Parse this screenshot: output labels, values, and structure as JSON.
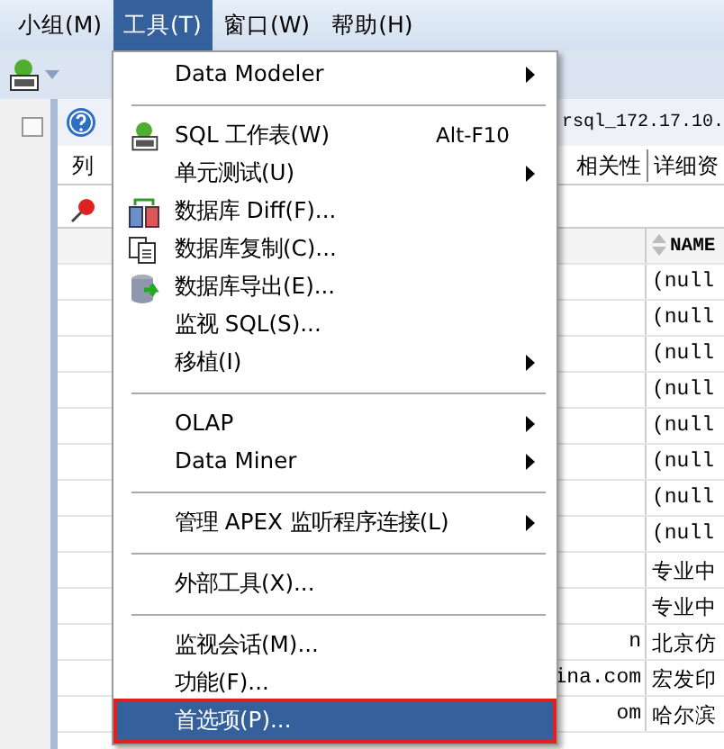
{
  "menubar": [
    {
      "label": "小组(M)",
      "selected": false
    },
    {
      "label": "工具(T)",
      "selected": true
    },
    {
      "label": "窗口(W)",
      "selected": false
    },
    {
      "label": "帮助(H)",
      "selected": false
    }
  ],
  "panel": {
    "title": "rsql_172.17.10.",
    "tabs": [
      {
        "label": "列"
      },
      {
        "label": "相关性"
      },
      {
        "label": "详细资"
      }
    ]
  },
  "grid": {
    "header": "NAME",
    "rows": [
      {
        "column_2": "",
        "name": "(null"
      },
      {
        "column_2": "",
        "name": "(null"
      },
      {
        "column_2": "",
        "name": "(null"
      },
      {
        "column_2": "",
        "name": "(null"
      },
      {
        "column_2": "",
        "name": "(null"
      },
      {
        "column_2": "",
        "name": "(null"
      },
      {
        "column_2": "",
        "name": "(null"
      },
      {
        "column_2": "",
        "name": "(null"
      },
      {
        "column_2": "",
        "name": "专业中"
      },
      {
        "column_2": "",
        "name": "专业中"
      },
      {
        "column_2": "n",
        "name": "北京仿"
      },
      {
        "column_2": "ina.com",
        "name": "宏发印"
      },
      {
        "column_2": "om",
        "name": "哈尔滨"
      }
    ]
  },
  "menu": [
    {
      "kind": "item",
      "label": "Data Modeler",
      "submenu": true,
      "selected": false
    },
    {
      "kind": "separator"
    },
    {
      "kind": "item",
      "label": "SQL 工作表(W)",
      "shortcut": "Alt-F10",
      "submenu": false,
      "selected": false
    },
    {
      "kind": "item",
      "label": "单元测试(U)",
      "submenu": true,
      "selected": false
    },
    {
      "kind": "item",
      "label": "数据库 Diff(F)...",
      "submenu": false,
      "selected": false
    },
    {
      "kind": "item",
      "label": "数据库复制(C)...",
      "submenu": false,
      "selected": false
    },
    {
      "kind": "item",
      "label": "数据库导出(E)...",
      "submenu": false,
      "selected": false
    },
    {
      "kind": "item",
      "label": "监视 SQL(S)...",
      "submenu": false,
      "selected": false
    },
    {
      "kind": "item",
      "label": "移植(I)",
      "submenu": true,
      "selected": false
    },
    {
      "kind": "separator"
    },
    {
      "kind": "item",
      "label": "OLAP",
      "submenu": true,
      "selected": false
    },
    {
      "kind": "item",
      "label": "Data Miner",
      "submenu": true,
      "selected": false
    },
    {
      "kind": "separator"
    },
    {
      "kind": "item",
      "label": "管理 APEX 监听程序连接(L)",
      "submenu": true,
      "selected": false
    },
    {
      "kind": "separator"
    },
    {
      "kind": "item",
      "label": "外部工具(X)...",
      "submenu": false,
      "selected": false
    },
    {
      "kind": "separator"
    },
    {
      "kind": "item",
      "label": "监视会话(M)...",
      "submenu": false,
      "selected": false
    },
    {
      "kind": "item",
      "label": "功能(F)...",
      "submenu": false,
      "selected": false
    },
    {
      "kind": "item",
      "label": "首选项(P)...",
      "submenu": false,
      "selected": true
    }
  ]
}
